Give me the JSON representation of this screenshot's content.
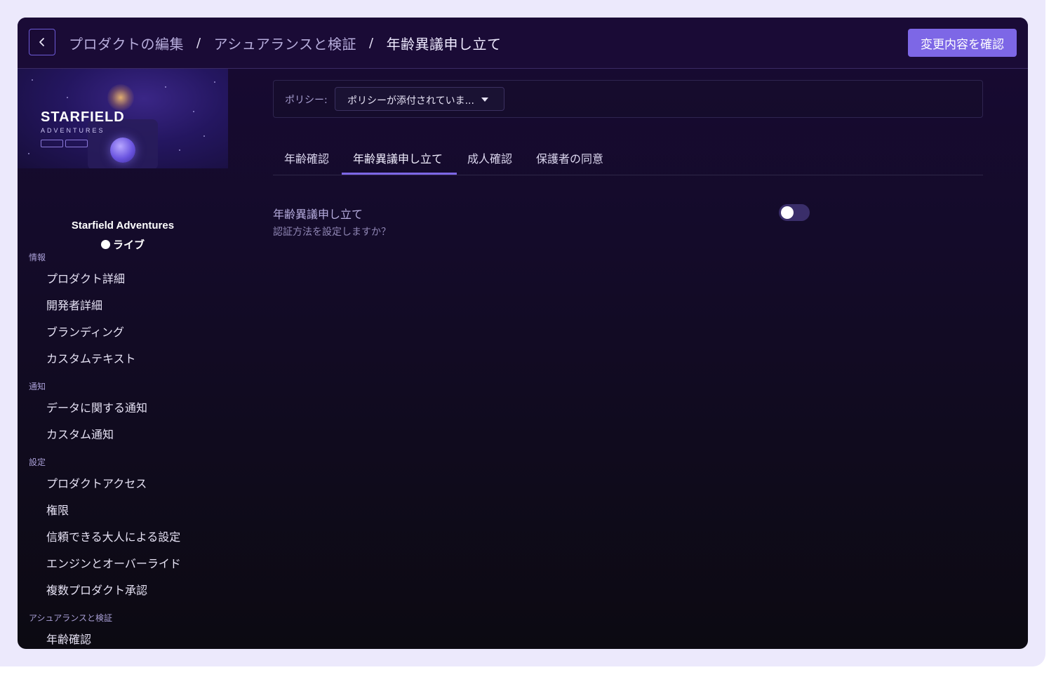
{
  "header": {
    "breadcrumb": [
      "プロダクトの編集",
      "アシュアランスと検証",
      "年齢異議申し立て"
    ],
    "separator": "/",
    "review_label": "変更内容を確認"
  },
  "product": {
    "thumbnail_title": "STARFIELD",
    "thumbnail_subtitle": "ADVENTURES",
    "name": "Starfield Adventures",
    "status": "ライブ"
  },
  "sidebar": {
    "sections": [
      {
        "label": "情報",
        "items": [
          "プロダクト詳細",
          "開発者詳細",
          "ブランディング",
          "カスタムテキスト"
        ]
      },
      {
        "label": "通知",
        "items": [
          "データに関する通知",
          "カスタム通知"
        ]
      },
      {
        "label": "設定",
        "items": [
          "プロダクトアクセス",
          "権限",
          "信頼できる大人による設定",
          "エンジンとオーバーライド",
          "複数プロダクト承認"
        ]
      },
      {
        "label": "アシュアランスと検証",
        "items": [
          "年齢確認"
        ]
      }
    ]
  },
  "policy": {
    "label": "ポリシー:",
    "selected": "ポリシーが添付されていま..."
  },
  "tabs": [
    {
      "label": "年齢確認",
      "active": false
    },
    {
      "label": "年齢異議申し立て",
      "active": true
    },
    {
      "label": "成人確認",
      "active": false
    },
    {
      "label": "保護者の同意",
      "active": false
    }
  ],
  "setting": {
    "title": "年齢異議申し立て",
    "description": "認証方法を設定しますか？",
    "enabled": false
  },
  "colors": {
    "accent": "#7d67e6",
    "frame": "#ece9fc",
    "background": "#140b2a"
  },
  "icons": {
    "back": "chevron-left-icon",
    "dropdown": "caret-down-icon",
    "status": "status-dot-icon"
  }
}
